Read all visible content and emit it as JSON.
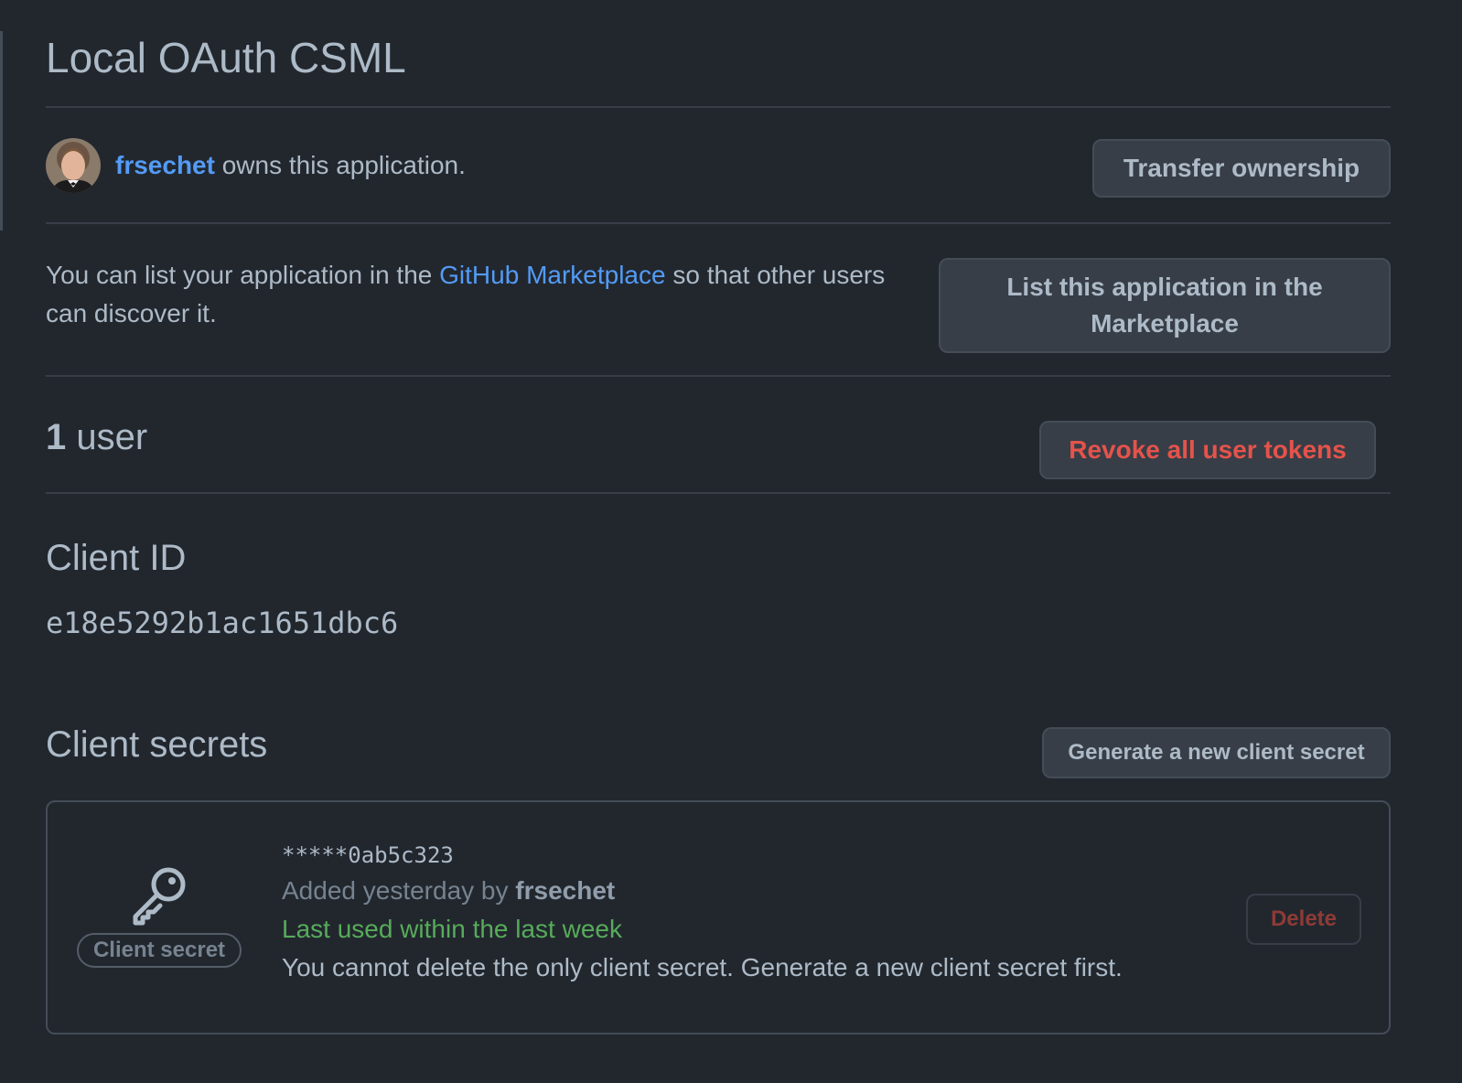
{
  "app": {
    "title": "Local OAuth CSML"
  },
  "owner": {
    "username": "frsechet",
    "suffix": " owns this application.",
    "transfer_label": "Transfer ownership"
  },
  "marketplace": {
    "text_before": "You can list your application in the ",
    "link_label": "GitHub Marketplace",
    "text_after": " so that other users can discover it.",
    "button_label": "List this application in the Marketplace"
  },
  "users": {
    "count": "1",
    "unit": "user",
    "revoke_label": "Revoke all user tokens"
  },
  "client_id": {
    "heading": "Client ID",
    "value": "e18e5292b1ac1651dbc6"
  },
  "client_secrets": {
    "heading": "Client secrets",
    "generate_label": "Generate a new client secret",
    "items": [
      {
        "badge": "Client secret",
        "masked_value": "*****0ab5c323",
        "added_prefix": "Added yesterday by ",
        "added_by": "frsechet",
        "last_used": "Last used within the last week",
        "note": "You cannot delete the only client secret. Generate a new client secret first.",
        "delete_label": "Delete",
        "icon": "key-icon"
      }
    ]
  },
  "colors": {
    "background": "#22272e",
    "text": "#adbac7",
    "link": "#539bf5",
    "danger": "#e5534b",
    "success": "#57ab5a"
  }
}
